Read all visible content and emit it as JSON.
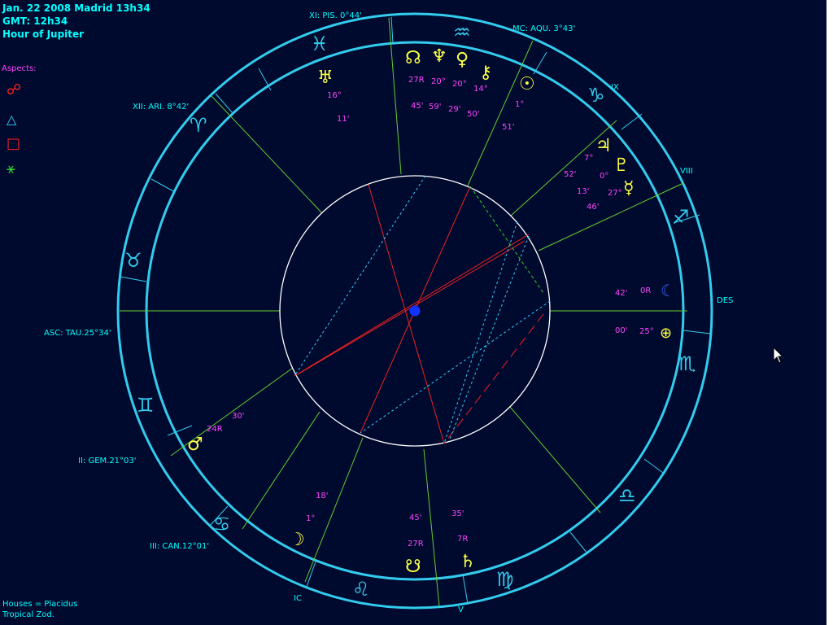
{
  "header": {
    "line1": "Jan. 22 2008 Madrid  13h34",
    "line2": "GMT: 12h34",
    "line3": "Hour of Jupiter"
  },
  "legend": {
    "title": "Aspects:",
    "items": [
      {
        "name": "opposition",
        "symbol": "☍",
        "color": "#ff2222"
      },
      {
        "name": "trine",
        "symbol": "△",
        "color": "#33ccff"
      },
      {
        "name": "square",
        "symbol": "□",
        "color": "#ff2222"
      },
      {
        "name": "sextile",
        "symbol": "⚹",
        "color": "#33cc33"
      }
    ]
  },
  "footer": {
    "houses": "Houses = Placidus",
    "zodiac": "Tropical Zod."
  },
  "cusps": {
    "mc": "MC: AQU. 3°43'",
    "xi": "XI: PIS. 0°44'",
    "xii": "XII: ARI. 8°42'",
    "asc": "ASC: TAU.25°34'",
    "ii": "II: GEM.21°03'",
    "iii": "III: CAN.12°01'",
    "ic": "IC",
    "v": "V",
    "des": "DES",
    "viii": "VIII",
    "ix": "IX"
  },
  "signs": {
    "aquarius": "♒",
    "pisces": "♓",
    "aries": "♈",
    "taurus": "♉",
    "gemini": "♊",
    "cancer": "♋",
    "leo": "♌",
    "virgo": "♍",
    "libra": "♎",
    "scorpio": "♏",
    "sagittarius": "♐",
    "capricorn": "♑"
  },
  "planets": {
    "uranus": {
      "glyph": "♅",
      "deg": "16°",
      "min": "11'"
    },
    "node": {
      "glyph": "☊",
      "deg": "27R",
      "min": "45'"
    },
    "neptune": {
      "glyph": "♆",
      "deg": "20°",
      "min": "59'"
    },
    "venus": {
      "glyph": "♀",
      "deg": "20°",
      "min": "29'"
    },
    "chiron": {
      "glyph": "⚷",
      "deg": "14°",
      "min": "50'"
    },
    "sun": {
      "glyph": "☉",
      "deg": "1°",
      "min": "51'"
    },
    "jupiter": {
      "glyph": "♃",
      "deg": "7°",
      "min": "52'"
    },
    "pluto": {
      "glyph": "♇",
      "deg": "0°",
      "min": "13'"
    },
    "mercury": {
      "glyph": "☿",
      "deg": "27°",
      "min": "46'"
    },
    "moon_r": {
      "glyph": "☾",
      "deg": "0R",
      "min": "42'"
    },
    "fortune": {
      "glyph": "⊕",
      "deg": "25°",
      "min": "00'"
    },
    "mars": {
      "glyph": "♂",
      "deg": "24R",
      "min": "30'"
    },
    "lilith": {
      "glyph": "☽",
      "deg": "1°",
      "min": "18'"
    },
    "snode": {
      "glyph": "☋",
      "deg": "27R",
      "min": "45'"
    },
    "saturn": {
      "glyph": "♄",
      "deg": "7R",
      "min": "35'"
    }
  },
  "colors": {
    "background": "#000a2e",
    "ring": "#33ccee",
    "house_lines": "#66cc33",
    "planets": "#ffff44",
    "degrees": "#ff44ff",
    "labels": "#00ffff",
    "center_dot": "#1133ff"
  }
}
